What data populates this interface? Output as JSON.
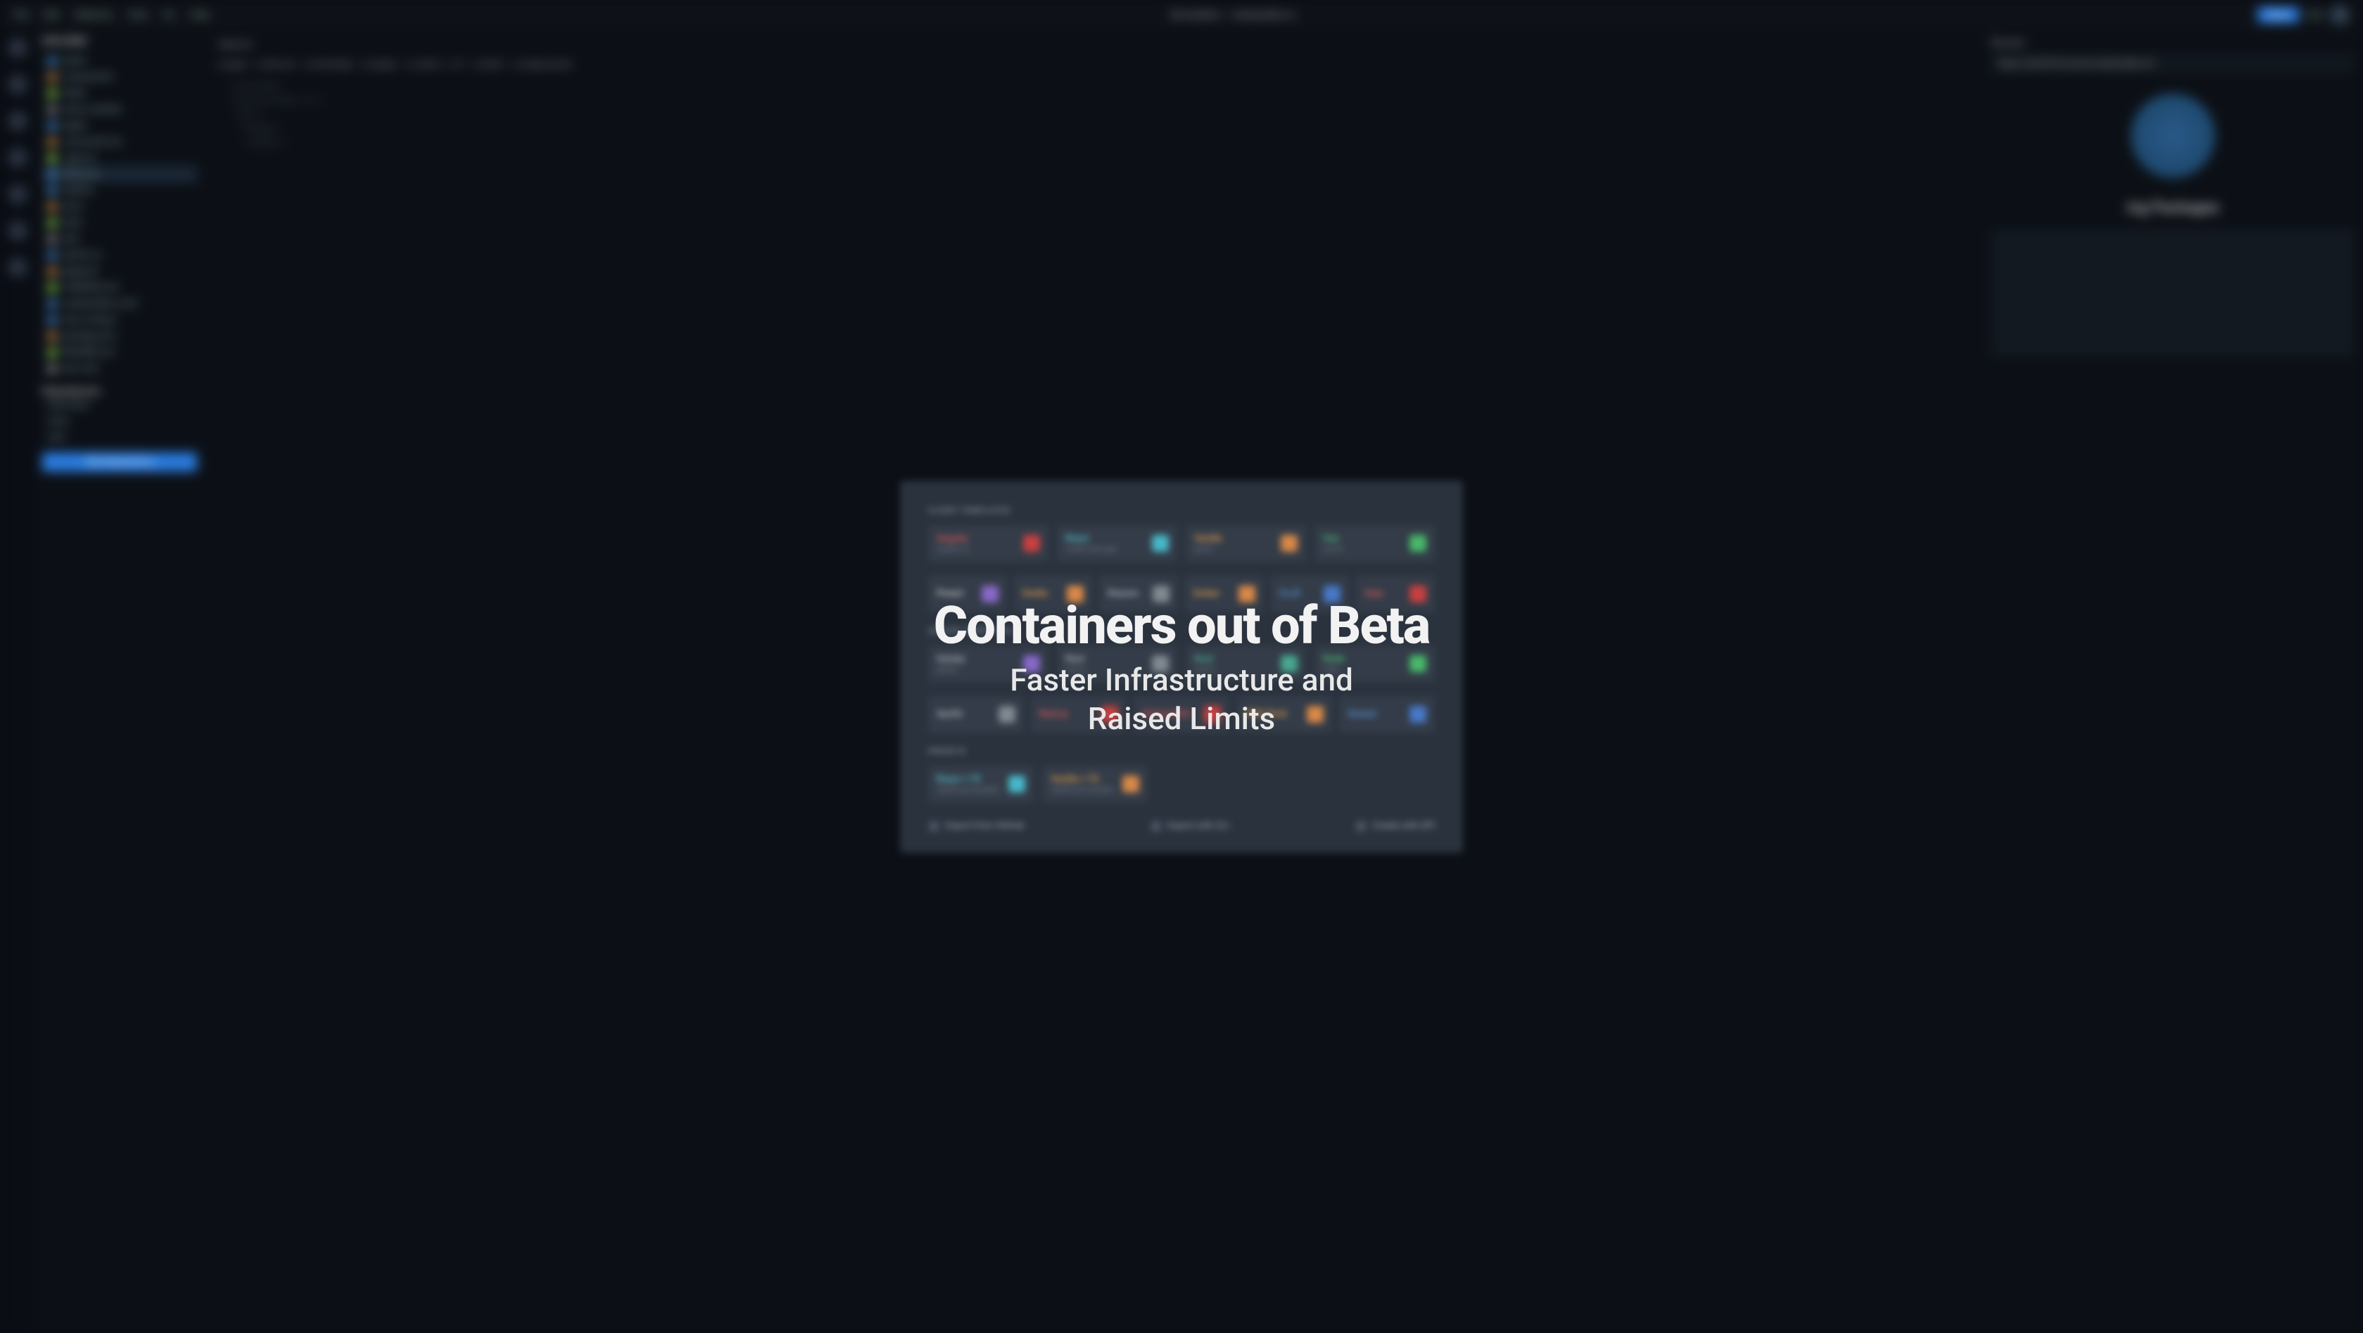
{
  "headline": {
    "title": "Containers out of Beta",
    "subtitle": "Faster Infrastructure and\nRaised Limits"
  },
  "topmenu": {
    "items": [
      "File",
      "Edit",
      "Selection",
      "View",
      "Go",
      "Help"
    ],
    "center": "My Sandbox – codesandbox.io",
    "share": "Share",
    "fork": "Fork"
  },
  "sidebar": {
    "header": "EXPLORER",
    "files": [
      "public",
      "components",
      "styles",
      "node_modules",
      "pages",
      "_document.tsx",
      "_app.tsx",
      "index.tsx",
      "readme",
      "store",
      "tests",
      "utils",
      "eslintrc.js",
      "gitignore",
      "FUNDING.yml",
      "codesandbox.conf",
      "next.config.js",
      "package.json",
      "README.md",
      "yarn.lock"
    ],
    "deps": "Dependencies",
    "depItems": [
      "react-dom",
      "react",
      "next"
    ],
    "addBtn": "Add Dependency"
  },
  "editor": {
    "tab": "index.tsx",
    "crumbs": [
      "pages",
      "index.tsx",
      "HomePage",
      "wrapper",
      "content",
      "h1",
      "button",
      "wrapper.green"
    ]
  },
  "preview": {
    "title": "Browser",
    "url": "https://csb-f0r7xd.vercel.codesandbox.io/",
    "heading": "ing Packages"
  },
  "modal": {
    "sections": {
      "client": "CLIENT TEMPLATES",
      "server": "SERVER TEMPLATES",
      "presets": "PRESETS"
    },
    "client": [
      {
        "name": "Angular",
        "sub": "angular-cli",
        "cls": "c-red",
        "ic": "ic-red"
      },
      {
        "name": "React",
        "sub": "create-react-app",
        "cls": "c-cyan",
        "ic": "ic-cyan"
      },
      {
        "name": "Vanilla",
        "sub": "parcel",
        "cls": "c-orange",
        "ic": "ic-orange"
      },
      {
        "name": "Vue",
        "sub": "vue-cli",
        "cls": "c-green",
        "ic": "ic-green"
      }
    ],
    "client2": [
      {
        "name": "Preact",
        "cls": "c-purple",
        "ic": "ic-purple"
      },
      {
        "name": "Svelte",
        "cls": "c-orange",
        "ic": "ic-orange"
      },
      {
        "name": "Reason",
        "cls": "c-grey",
        "ic": "ic-grey"
      },
      {
        "name": "Ember",
        "cls": "c-orange",
        "ic": "ic-orange"
      },
      {
        "name": "CxJS",
        "cls": "c-blue",
        "ic": "ic-blue"
      },
      {
        "name": "Dojo",
        "cls": "c-red",
        "ic": "ic-red"
      }
    ],
    "server": [
      {
        "name": "Gatsby",
        "sub": "gatsby",
        "cls": "c-grey",
        "ic": "ic-purple"
      },
      {
        "name": "Next",
        "sub": "next.js",
        "cls": "c-grey",
        "ic": "ic-grey"
      },
      {
        "name": "Nuxt",
        "sub": "nuxt.js",
        "cls": "c-teal",
        "ic": "ic-teal"
      },
      {
        "name": "Node",
        "sub": "node",
        "cls": "c-green",
        "ic": "ic-green"
      }
    ],
    "server2": [
      {
        "name": "Apollo",
        "cls": "c-grey",
        "ic": "ic-grey"
      },
      {
        "name": "Nest.js",
        "cls": "c-red",
        "ic": "ic-red"
      },
      {
        "name": "Styleguidist",
        "cls": "c-red",
        "ic": "ic-red"
      },
      {
        "name": "MDX Deck",
        "cls": "c-orange",
        "ic": "ic-orange"
      },
      {
        "name": "Quasar",
        "cls": "c-blue",
        "ic": "ic-blue"
      }
    ],
    "presets": [
      {
        "name": "React + TS",
        "sub": "TypeScript template",
        "cls": "c-cyan",
        "ic": "ic-cyan"
      },
      {
        "name": "Vanilla + TS",
        "sub": "TypeScript template",
        "cls": "c-orange",
        "ic": "ic-orange"
      }
    ],
    "footer": {
      "import": "Import from GitHub",
      "export": "Export with CLI",
      "api": "Create with API"
    }
  }
}
